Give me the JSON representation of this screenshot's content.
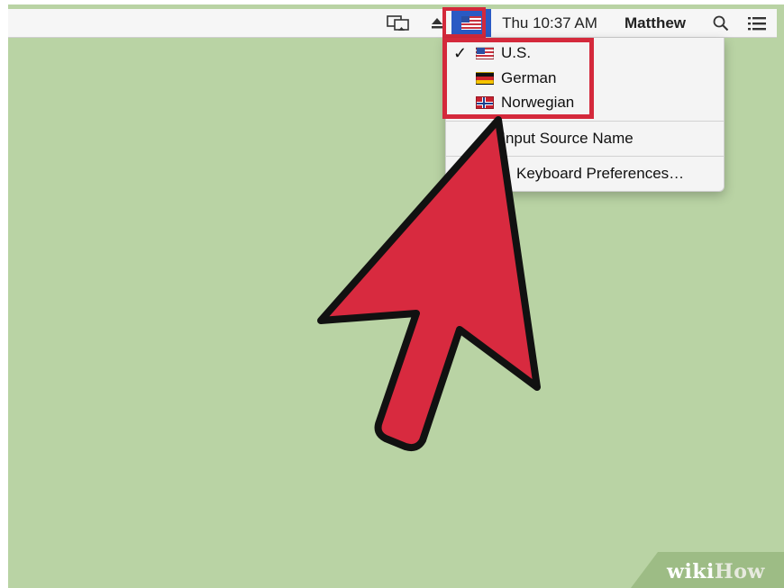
{
  "menubar": {
    "clock": "Thu 10:37 AM",
    "user": "Matthew",
    "icons": [
      "airplay-display-icon",
      "eject-icon",
      "us-flag-icon",
      "search-icon",
      "list-icon"
    ]
  },
  "input_menu": {
    "sources": [
      {
        "label": "U.S.",
        "flag": "us-flag-icon",
        "checked": true
      },
      {
        "label": "German",
        "flag": "german-flag-icon",
        "checked": false
      },
      {
        "label": "Norwegian",
        "flag": "norwegian-flag-icon",
        "checked": false
      }
    ],
    "show_name_label": "Show Input Source Name",
    "show_name_visible": "y Input Source Name",
    "prefs_label": "Open Keyboard Preferences…",
    "prefs_visible": "Keyboard Preferences…",
    "check_glyph": "✓"
  },
  "annotation": {
    "highlight_color": "#d4293b",
    "arrow_color": "#d82a3f"
  },
  "watermark": {
    "part1": "wiki",
    "part2": "How"
  },
  "colors": {
    "desktop": "#b9d3a4",
    "menubar": "#f6f6f6",
    "selected_menu_extra": "#2a5ac4"
  }
}
